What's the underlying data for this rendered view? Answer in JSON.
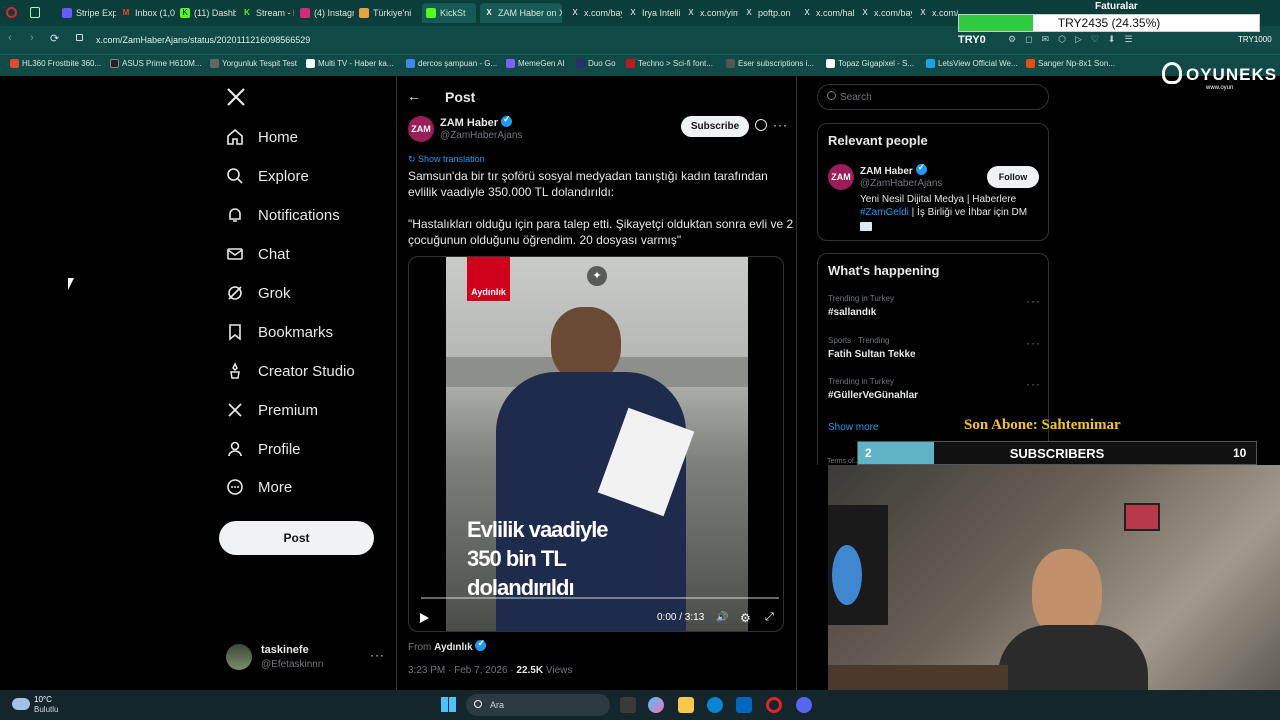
{
  "browser": {
    "tabs": [
      {
        "label": "Stripe Exp"
      },
      {
        "label": "Inbox (1,0"
      },
      {
        "label": "(11) Dashb"
      },
      {
        "label": "Stream - K"
      },
      {
        "label": "(4) Instagr"
      },
      {
        "label": "Türkiye'ni"
      },
      {
        "label": "KickSt"
      },
      {
        "label": "ZAM Haber on X"
      },
      {
        "label": "x.com/bay"
      },
      {
        "label": "Irya Intelli"
      },
      {
        "label": "x.com/yim"
      },
      {
        "label": "poftp.on"
      },
      {
        "label": "x.com/hal"
      },
      {
        "label": "x.com/bay"
      },
      {
        "label": "x.com/sp"
      }
    ],
    "url": "x.com/ZamHaberAjans/status/2020111216098566529",
    "bookmarks": [
      "HL360 Frostbite 360...",
      "ASUS Prime H610M...",
      "Yorgunluk Tespit Test",
      "Multi TV - Haber ka...",
      "dercos şampuan - G...",
      "MemeGen AI",
      "Duo Go",
      "Techno > Sci-fi font...",
      "Eser subscriptions i...",
      "Topaz Gigapixel - S...",
      "LetsView Official We...",
      "Sanger Np-8x1 Son..."
    ]
  },
  "overlay": {
    "bar_text": "TRY2435 (24.35%)",
    "bar_label": "TRY0",
    "faturalar": "Faturalar",
    "brand": "OYUNEKS",
    "brand_sub": "www.oyun",
    "son_abone": "Son Abone: Sahtemimar",
    "subs_current": "2",
    "subs_label": "SUBSCRIBERS",
    "subs_goal": "10",
    "top_right_amount": "TRY1000"
  },
  "nav": {
    "home": "Home",
    "explore": "Explore",
    "notifications": "Notifications",
    "chat": "Chat",
    "grok": "Grok",
    "bookmarks": "Bookmarks",
    "creator_studio": "Creator Studio",
    "premium": "Premium",
    "profile": "Profile",
    "more": "More",
    "post_button": "Post"
  },
  "account": {
    "name": "taskinefe",
    "handle": "@Efetaskinnn"
  },
  "post": {
    "header": "Post",
    "author_name": "ZAM Haber",
    "author_handle": "@ZamHaberAjans",
    "avatar_text": "ZAM",
    "subscribe_label": "Subscribe",
    "show_translation": "Show translation",
    "text_line1": "Samsun'da bir tır şoförü sosyal medyadan tanıştığı kadın tarafından",
    "text_line2": "evlilik vaadiyle 350.000 TL dolandırıldı:",
    "quote_line1": "\"Hastalıkları olduğu için para talep etti. Şikayetçi olduktan sonra evli ve 2",
    "quote_line2": "çocuğunun olduğunu öğrendim. 20 dosyası varmış\"",
    "video_logo": "Aydınlık",
    "video_caption1": "Evlilik vaadiyle",
    "video_caption2": "350 bin TL",
    "video_caption3": "dolandırıldı",
    "video_time": "0:00 / 3:13",
    "video_progress": 0,
    "from_label": "From",
    "from_source": "Aydınlık",
    "timestamp": "3:23 PM · Feb 7, 2026 ·",
    "views_count": "22.5K",
    "views_label": "Views"
  },
  "sidebar": {
    "search_placeholder": "Search",
    "relevant_title": "Relevant people",
    "person_name": "ZAM Haber",
    "person_handle": "@ZamHaberAjans",
    "follow_label": "Follow",
    "bio_line1": "Yeni Nesil Dijital Medya | Haberlere",
    "bio_hashtag": "#ZamGeldi",
    "bio_line2_rest": " | İş Birliği ve İhbar için DM",
    "happening_title": "What's happening",
    "trends": [
      {
        "context": "Trending in Turkey",
        "name": "#sallandık"
      },
      {
        "context": "Sports · Trending",
        "name": "Fatih Sultan Tekke"
      },
      {
        "context": "Trending in Turkey",
        "name": "#GüllerVeGünahlar"
      }
    ],
    "show_more": "Show more",
    "terms": "Terms of..."
  },
  "taskbar": {
    "temperature": "10°C",
    "weather": "Bulutlu",
    "search_placeholder": "Ara"
  },
  "colors": {
    "accent": "#1d9bf0",
    "browser_bg": "#0f4a46",
    "sub_bar": "#5fb3c5",
    "progress_green": "#2ecc40"
  }
}
